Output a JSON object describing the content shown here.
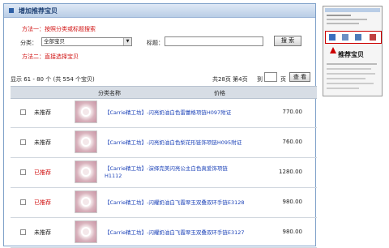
{
  "panel": {
    "title": "增加推荐宝贝"
  },
  "method1": "方法一：按照分类或标题搜索",
  "method2": "方法二：直接选择宝贝",
  "search": {
    "category_label": "分类：",
    "category_value": "全部宝贝",
    "title_label": "标题：",
    "title_value": "",
    "button": "搜 索"
  },
  "summary": "显示 61 - 80 个 (共 554 个宝贝)",
  "pagination": {
    "total": "共28页 第4页",
    "goto_prefix": "到",
    "goto_value": "",
    "goto_suffix": "页",
    "button": "查 看"
  },
  "columns": {
    "name": "分类名称",
    "price": "价格"
  },
  "rows": [
    {
      "status": "未推荐",
      "name": "【Carrie精工坊】-闪亮奶油白色雷蕾格项链H097附证",
      "price": "770.00"
    },
    {
      "status": "未推荐",
      "name": "【Carrie精工坊】-闪亮奶油白色梨花形链饰项链H095附证",
      "price": "760.00"
    },
    {
      "status": "已推荐",
      "name": "【Carrie精工坊】-演绎完美闪亮公主白色真爱饰项链H1112",
      "price": "1280.00"
    },
    {
      "status": "已推荐",
      "name": "【Carrie精工坊】-闪耀奶油白飞霞翠玉双叠双环手链E3128",
      "price": "980.00"
    },
    {
      "status": "未推荐",
      "name": "【Carrie精工坊】-闪耀奶油白飞霞翠玉双叠双环手链E3127",
      "price": "980.00"
    }
  ],
  "sidebar": {
    "callout": "推荐宝贝"
  },
  "colors": {
    "recommended": "#d01010",
    "not_recommended": "#222222",
    "link": "#1d43b8"
  }
}
